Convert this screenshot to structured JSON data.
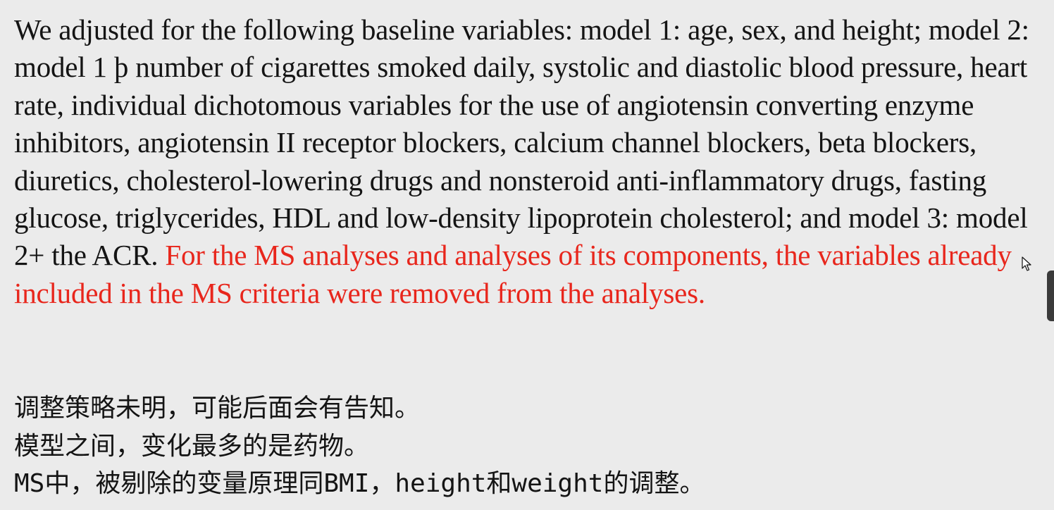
{
  "paragraph": {
    "text_black": "We adjusted for the following baseline variables: model 1: age, sex, and height; model 2: model 1 þ number of cigarettes smoked daily, systolic and diastolic blood pressure, heart rate, individual dichotomous variables for the use of angiotensin converting enzyme inhibitors, angiotensin II receptor blockers, calcium channel blockers, beta blockers, diuretics, cholesterol-lowering drugs and nonsteroid anti-inflammatory drugs, fasting glucose, triglycerides, HDL and low-density lipoprotein cholesterol; and model 3: model 2+ the ACR. ",
    "text_red": "For the MS analyses and analyses of its components, the variables already included in the MS criteria were removed from the analyses.",
    "highlight_color": "#e8261c"
  },
  "notes": [
    "调整策略未明，可能后面会有告知。",
    "模型之间，变化最多的是药物。",
    "MS中，被剔除的变量原理同BMI，height和weight的调整。"
  ],
  "icons": {
    "cursor": "mouse-pointer-icon"
  }
}
